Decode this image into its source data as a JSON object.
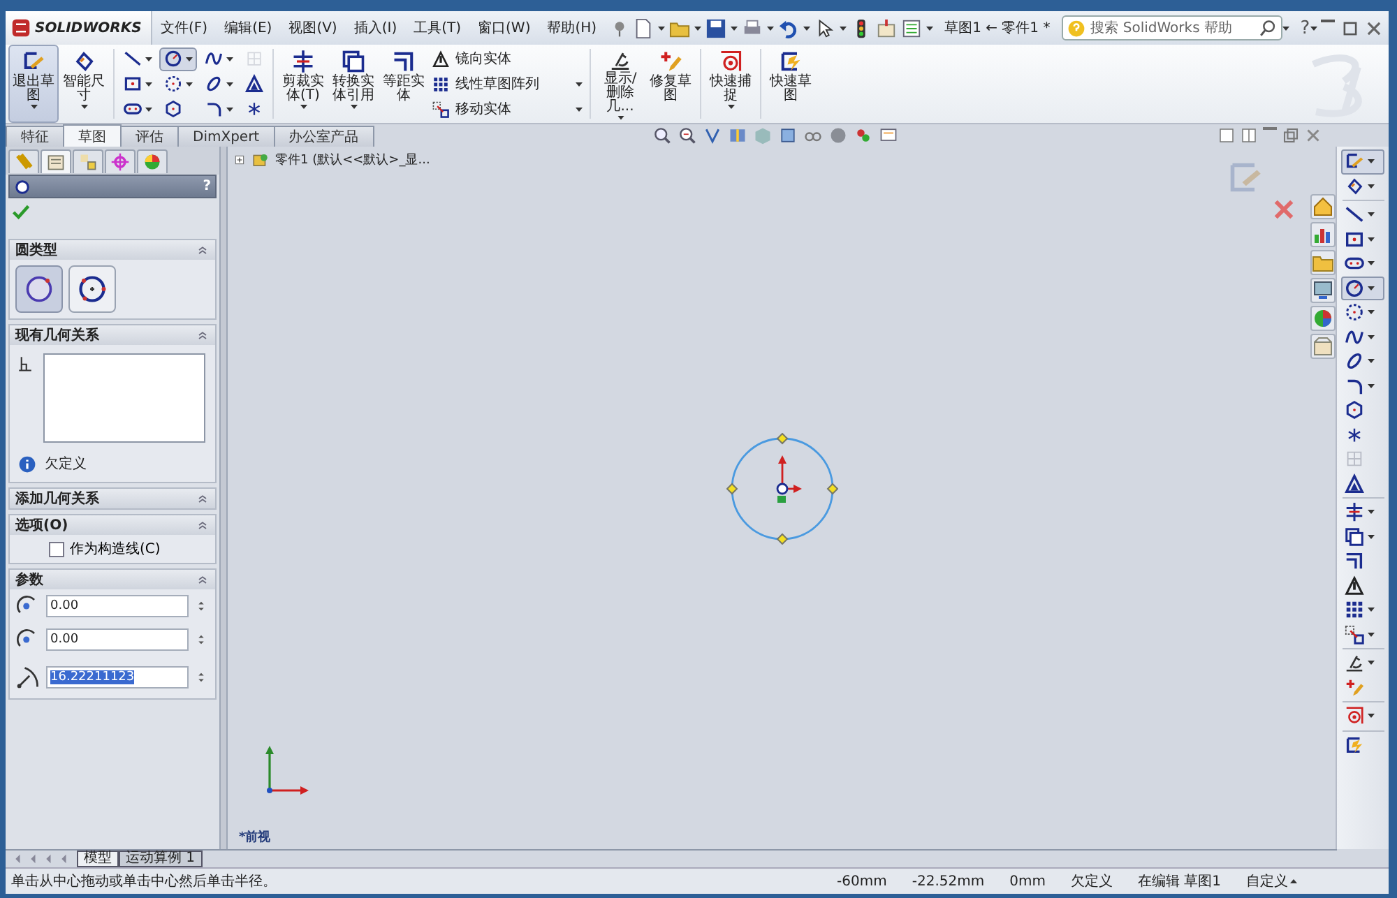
{
  "title_bar": {
    "logo": "SOLIDWORKS",
    "menus": [
      "文件(F)",
      "编辑(E)",
      "视图(V)",
      "插入(I)",
      "工具(T)",
      "窗口(W)",
      "帮助(H)"
    ],
    "document_title": "草图1 ← 零件1 *",
    "search": {
      "placeholder": "搜索 SolidWorks 帮助"
    },
    "help": "?"
  },
  "ribbon": {
    "left_buttons": [
      {
        "kind": "exit-sketch",
        "label": "退出草图",
        "selected": true,
        "dropdown": true
      },
      {
        "kind": "dimension",
        "label": "智能尺寸",
        "selected": false,
        "dropdown": true
      }
    ],
    "tool_grid": [
      {
        "kind": "line",
        "selected": false,
        "dropdown": true
      },
      {
        "kind": "circle",
        "selected": true,
        "dropdown": true
      },
      {
        "kind": "spline",
        "selected": false,
        "dropdown": true
      },
      {
        "kind": "grid",
        "selected": false,
        "dropdown": false,
        "disabled": true
      },
      {
        "kind": "rectangle",
        "selected": false,
        "dropdown": true
      },
      {
        "kind": "dotted-arc",
        "selected": false,
        "dropdown": true
      },
      {
        "kind": "ellipse",
        "selected": false,
        "dropdown": true
      },
      {
        "kind": "text",
        "selected": false,
        "dropdown": false,
        "disabled": false
      },
      {
        "kind": "slot",
        "selected": false,
        "dropdown": true
      },
      {
        "kind": "polygon",
        "selected": false,
        "dropdown": false
      },
      {
        "kind": "fillet",
        "selected": false,
        "dropdown": true
      },
      {
        "kind": "point",
        "selected": false,
        "dropdown": false
      }
    ],
    "middle_buttons": [
      {
        "kind": "trim",
        "label": "剪裁实体(T)",
        "dropdown": true
      },
      {
        "kind": "convert",
        "label": "转换实体引用",
        "dropdown": true
      },
      {
        "kind": "offset",
        "label": "等距实体",
        "dropdown": false
      }
    ],
    "small_buttons": [
      {
        "kind": "mirror",
        "label": "镜向实体",
        "dropdown": false
      },
      {
        "kind": "pattern",
        "label": "线性草图阵列",
        "dropdown": true
      },
      {
        "kind": "move",
        "label": "移动实体",
        "dropdown": true
      }
    ],
    "right_buttons": [
      {
        "kind": "display",
        "label": "显示/删除几...",
        "dropdown": true
      },
      {
        "kind": "repair",
        "label": "修复草图",
        "dropdown": false
      },
      {
        "kind": "snap",
        "label": "快速捕捉",
        "dropdown": true
      },
      {
        "kind": "quick-sketch",
        "label": "快速草图",
        "dropdown": false
      }
    ]
  },
  "command_tabs": [
    {
      "label": "特征",
      "selected": false
    },
    {
      "label": "草图",
      "selected": true
    },
    {
      "label": "评估",
      "selected": false
    },
    {
      "label": "DimXpert",
      "selected": false
    },
    {
      "label": "办公室产品",
      "selected": false
    }
  ],
  "property_manager": {
    "tabs": [
      {
        "kind": "feature-tree",
        "selected": false
      },
      {
        "kind": "property",
        "selected": true
      },
      {
        "kind": "config",
        "selected": false
      },
      {
        "kind": "target",
        "selected": false
      },
      {
        "kind": "display",
        "selected": false
      }
    ],
    "help": "?",
    "sections": [
      {
        "kind": "options",
        "title": "圆类型",
        "options": [
          {
            "kind": "center",
            "selected": true
          },
          {
            "kind": "perimeter",
            "selected": false
          }
        ]
      },
      {
        "kind": "relations",
        "title": "现有几何关系",
        "status": "欠定义"
      },
      {
        "kind": "header",
        "title": "添加几何关系"
      },
      {
        "kind": "checkbox",
        "title": "选项(O)",
        "checkbox": {
          "label": "作为构造线(C)",
          "checked": false
        }
      },
      {
        "kind": "parameters",
        "title": "参数",
        "fields": [
          {
            "kind": "x",
            "value": "0.00",
            "selected": false
          },
          {
            "kind": "y",
            "value": "0.00",
            "selected": false
          },
          {
            "kind": "radius",
            "value": "16.22211123",
            "selected": true
          }
        ]
      }
    ]
  },
  "viewport": {
    "tree_item": "零件1  (默认<<默认>_显...",
    "view_label": "*前视"
  },
  "right_toolbar": {
    "groups": [
      [
        {
          "kind": "exit-sketch",
          "selected": true,
          "dropdown": true
        },
        {
          "kind": "dimension",
          "selected": false,
          "dropdown": true
        }
      ],
      [
        {
          "kind": "line",
          "selected": false,
          "dropdown": true
        },
        {
          "kind": "rectangle",
          "selected": false,
          "dropdown": true
        },
        {
          "kind": "slot",
          "selected": false,
          "dropdown": true
        },
        {
          "kind": "circle",
          "selected": true,
          "dropdown": true
        },
        {
          "kind": "dotted-arc",
          "selected": false,
          "dropdown": true
        },
        {
          "kind": "spline",
          "selected": false,
          "dropdown": true
        },
        {
          "kind": "ellipse",
          "selected": false,
          "dropdown": true
        },
        {
          "kind": "fillet",
          "selected": false,
          "dropdown": true
        },
        {
          "kind": "polygon",
          "selected": false,
          "dropdown": false
        },
        {
          "kind": "point",
          "selected": false,
          "dropdown": false
        },
        {
          "kind": "grid",
          "selected": false,
          "dropdown": false
        },
        {
          "kind": "text",
          "selected": false,
          "dropdown": false
        }
      ],
      [
        {
          "kind": "trim",
          "selected": false,
          "dropdown": true
        },
        {
          "kind": "convert",
          "selected": false,
          "dropdown": true
        },
        {
          "kind": "offset",
          "selected": false,
          "dropdown": false
        },
        {
          "kind": "mirror",
          "selected": false,
          "dropdown": false
        },
        {
          "kind": "pattern",
          "selected": false,
          "dropdown": true
        },
        {
          "kind": "move",
          "selected": false,
          "dropdown": true
        }
      ],
      [
        {
          "kind": "display",
          "selected": false,
          "dropdown": true
        },
        {
          "kind": "repair",
          "selected": false,
          "dropdown": false
        }
      ],
      [
        {
          "kind": "snap",
          "selected": false,
          "dropdown": true
        }
      ],
      [
        {
          "kind": "quick-sketch",
          "selected": false,
          "dropdown": false
        }
      ]
    ]
  },
  "bottom_tabs": [
    {
      "label": "模型",
      "selected": true
    },
    {
      "label": "运动算例 1",
      "selected": false
    }
  ],
  "status_bar": {
    "message": "单击从中心拖动或单击中心然后单击半径。",
    "fields": [
      "-60mm",
      "-22.52mm",
      "0mm",
      "欠定义",
      "在编辑 草图1",
      "自定义"
    ]
  }
}
